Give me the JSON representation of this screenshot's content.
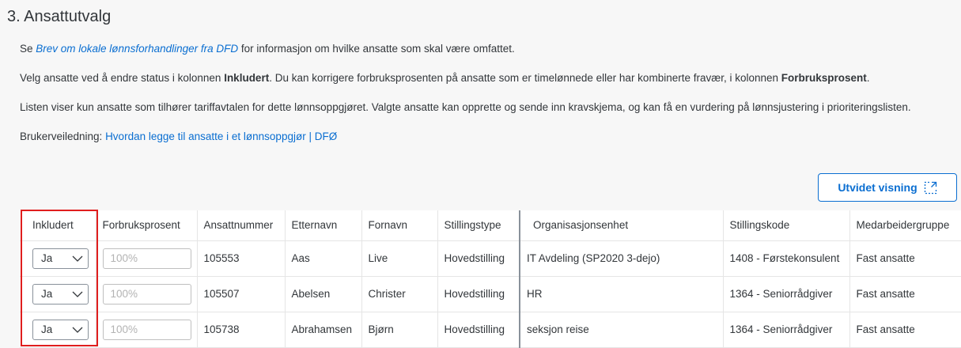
{
  "section": {
    "title": "3. Ansattutvalg"
  },
  "intro": {
    "p1_prefix": "Se ",
    "p1_link": "Brev om lokale lønnsforhandlinger fra DFD",
    "p1_suffix": " for informasjon om hvilke ansatte som skal være omfattet.",
    "p2_a": "Velg ansatte ved å endre status i kolonnen ",
    "p2_b": "Inkludert",
    "p2_c": ". Du kan korrigere forbruksprosenten på ansatte som er timelønnede eller har kombinerte fravær, i kolonnen ",
    "p2_d": "Forbruksprosent",
    "p2_e": ".",
    "p3": "Listen viser kun ansatte som tilhører tariffavtalen for dette lønnsoppgjøret. Valgte ansatte kan opprette og sende inn kravskjema, og kan få en vurdering på lønnsjustering i prioriteringslisten.",
    "p4_prefix": "Brukerveiledning: ",
    "p4_link": "Hvordan legge til ansatte i et lønnsoppgjør | DFØ"
  },
  "toolbar": {
    "expand_label": "Utvidet visning",
    "expand_icon": "external-expand-icon"
  },
  "table": {
    "headers": [
      "Inkludert",
      "Forbruksprosent",
      "Ansattnummer",
      "Etternavn",
      "Fornavn",
      "Stillingstype",
      "Organisasjonsenhet",
      "Stillingskode",
      "Medarbeidergruppe"
    ],
    "rows": [
      {
        "inkludert": "Ja",
        "forbruk_placeholder": "100%",
        "ansattnummer": "105553",
        "etternavn": "Aas",
        "fornavn": "Live",
        "stillingstype": "Hovedstilling",
        "org": "IT Avdeling (SP2020 3-dejo)",
        "stillingskode": "1408 - Førstekonsulent",
        "gruppe": "Fast ansatte"
      },
      {
        "inkludert": "Ja",
        "forbruk_placeholder": "100%",
        "ansattnummer": "105507",
        "etternavn": "Abelsen",
        "fornavn": "Christer",
        "stillingstype": "Hovedstilling",
        "org": "HR",
        "stillingskode": "1364 - Seniorrådgiver",
        "gruppe": "Fast ansatte"
      },
      {
        "inkludert": "Ja",
        "forbruk_placeholder": "100%",
        "ansattnummer": "105738",
        "etternavn": "Abrahamsen",
        "fornavn": "Bjørn",
        "stillingstype": "Hovedstilling",
        "org": "seksjon reise",
        "stillingskode": "1364 - Seniorrådgiver",
        "gruppe": "Fast ansatte"
      }
    ]
  },
  "colors": {
    "link": "#0a6ed1",
    "highlight_border": "#e01e1e",
    "text": "#32363a"
  }
}
